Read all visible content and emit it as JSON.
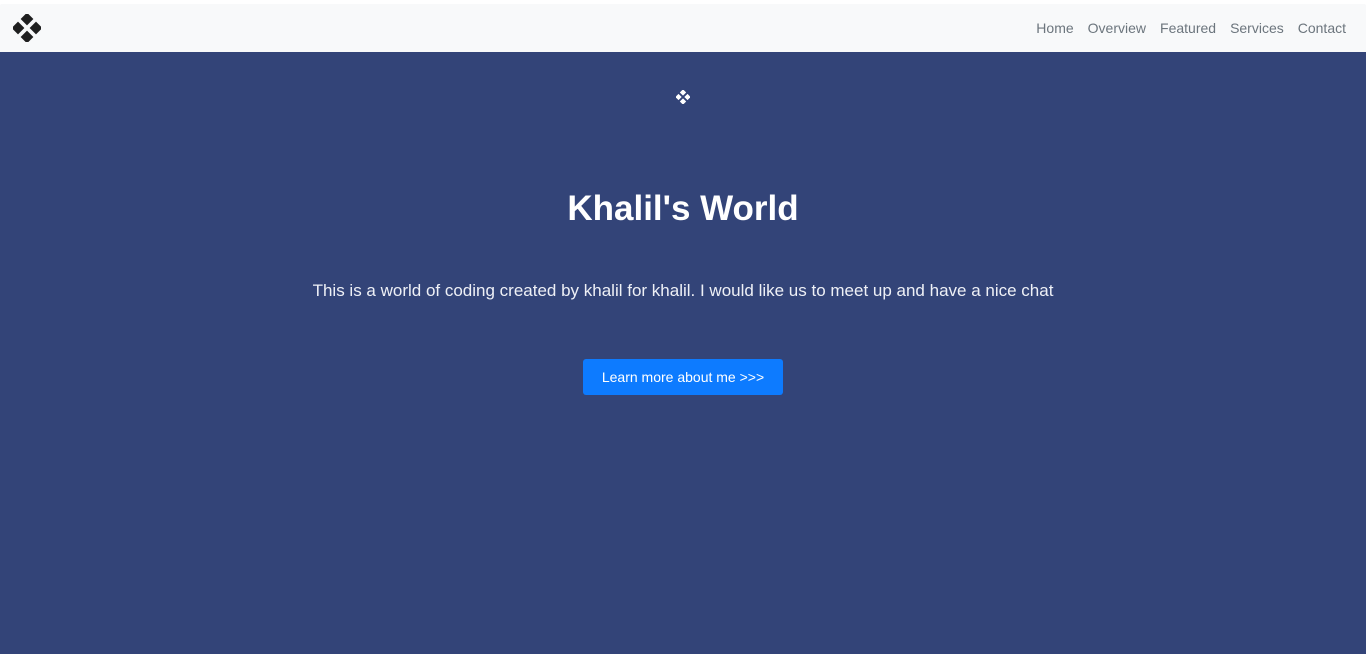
{
  "navbar": {
    "brand_icon": "diamond-grid-icon",
    "links": [
      {
        "label": "Home"
      },
      {
        "label": "Overview"
      },
      {
        "label": "Featured"
      },
      {
        "label": "Services"
      },
      {
        "label": "Contact"
      }
    ]
  },
  "hero": {
    "icon": "diamond-grid-icon",
    "title": "Khalil's World",
    "text": "This is a world of coding created by khalil for khalil. I would like us to meet up and have a nice chat",
    "button_label": "Learn more about me >>>"
  },
  "colors": {
    "navbar_bg": "#f8f9fa",
    "hero_bg": "#334478",
    "button_bg": "#0d7bff",
    "nav_link": "#6c757d"
  }
}
